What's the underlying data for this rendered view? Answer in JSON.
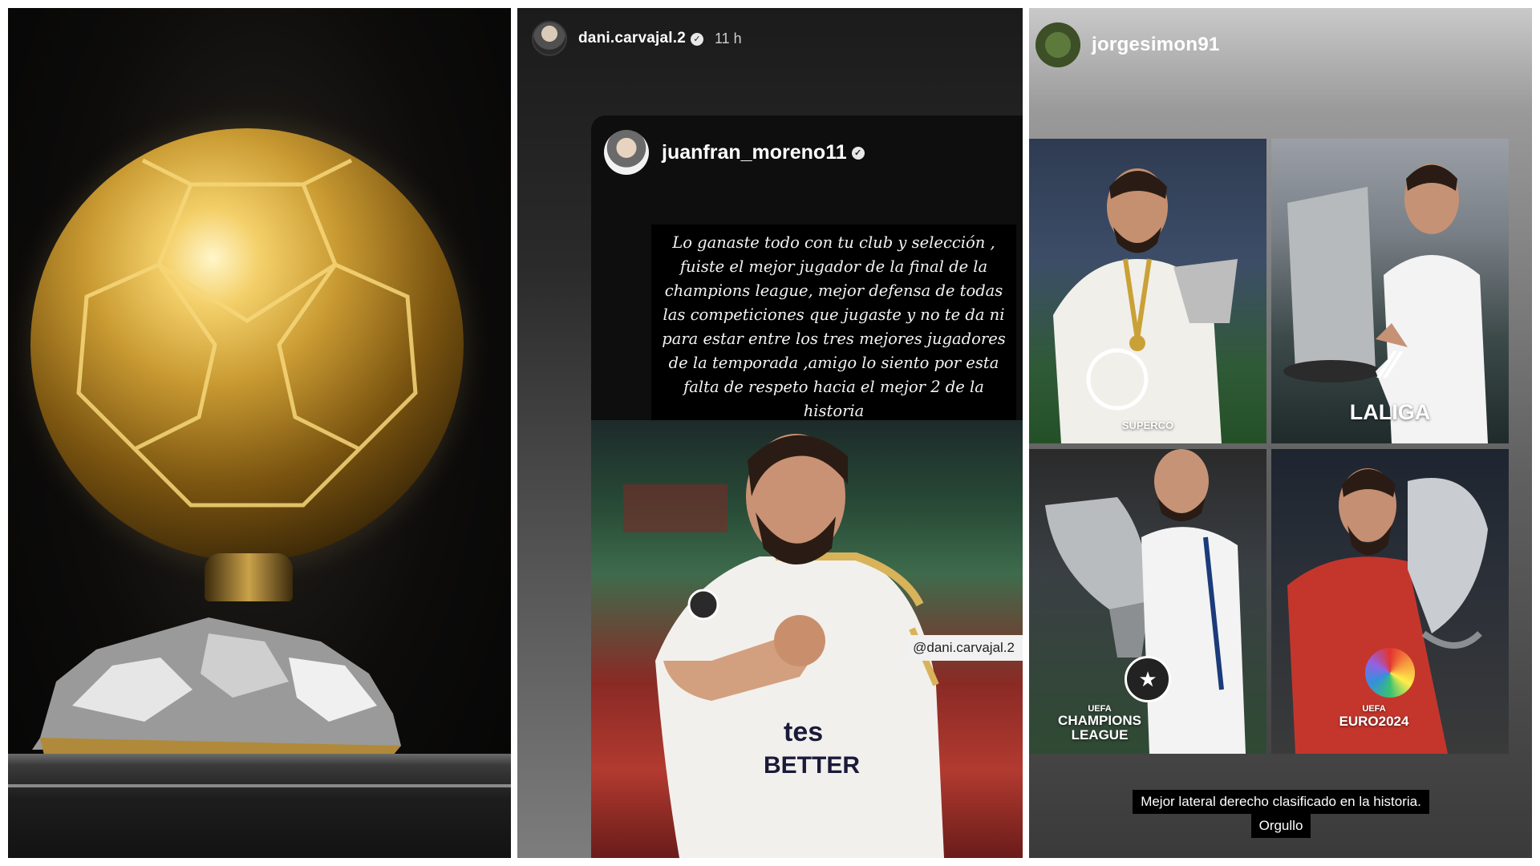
{
  "panel_trophy": {
    "description_icon": "golden-ball-icon"
  },
  "story_dani": {
    "username": "dani.carvajal.2",
    "verified_icon": "verified-icon",
    "time": "11 h",
    "reshared_post": {
      "username": "juanfran_moreno11",
      "quote": "Lo ganaste todo con tu club y selección , fuiste el mejor jugador de la final de la champions league, mejor defensa de todas las competiciones que jugaste y no te da ni para estar entre los tres mejores jugadores de la temporada ,amigo lo siento por esta falta de respeto hacia el mejor 2 de la historia",
      "mention": "@dani.carvajal.2",
      "jersey_text_1": "tes",
      "jersey_text_2": "BETTER"
    }
  },
  "story_jorge": {
    "username": "jorgesimon91",
    "tiles": [
      {
        "name": "supercopa",
        "label": "SUPERCO"
      },
      {
        "name": "laliga",
        "label": "LALIGA"
      },
      {
        "name": "champions",
        "label_line1": "CHAMPIONS",
        "label_line2": "LEAGUE",
        "sub": "UEFA"
      },
      {
        "name": "euro",
        "label": "EURO2024",
        "sub": "UEFA"
      }
    ],
    "caption_line1": "Mejor lateral derecho clasificado en la historia.",
    "caption_line2": "Orgullo"
  }
}
